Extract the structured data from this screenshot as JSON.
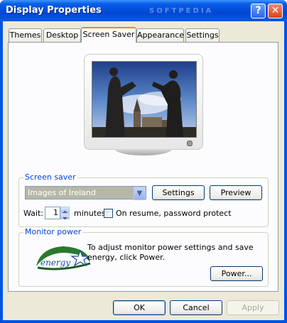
{
  "window": {
    "title": "Display Properties",
    "help_icon": "?",
    "close_icon": "✕"
  },
  "tabs": [
    {
      "label": "Themes"
    },
    {
      "label": "Desktop"
    },
    {
      "label": "Screen Saver",
      "active": true
    },
    {
      "label": "Appearance"
    },
    {
      "label": "Settings"
    }
  ],
  "screen_saver": {
    "group_label": "Screen saver",
    "selected": "Images of Ireland",
    "settings_button": "Settings",
    "preview_button": "Preview",
    "wait_label": "Wait:",
    "wait_value": "1",
    "minutes_label": "minutes",
    "password_checkbox_label": "On resume, password protect",
    "password_checked": false
  },
  "monitor_power": {
    "group_label": "Monitor power",
    "description": "To adjust monitor power settings and save energy, click Power.",
    "power_button": "Power...",
    "logo_text": "energy"
  },
  "footer": {
    "ok": "OK",
    "cancel": "Cancel",
    "apply": "Apply"
  },
  "colors": {
    "title_blue": "#0054e3",
    "group_label_blue": "#0046d5",
    "tab_accent": "#e68b2c"
  }
}
